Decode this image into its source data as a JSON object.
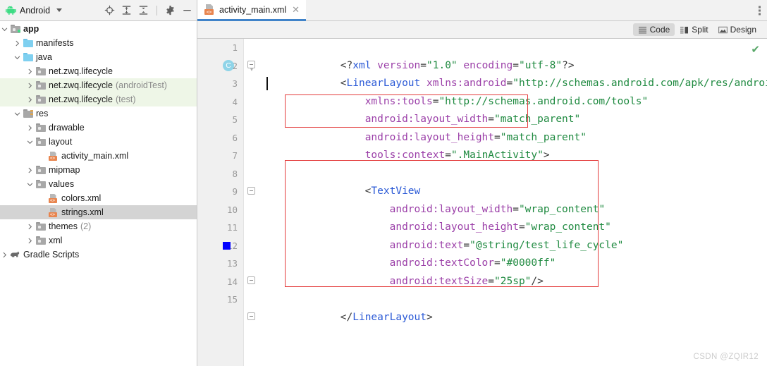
{
  "window": {
    "panel_title": "Android",
    "panel_dropdown_icon": "chevron-down-icon",
    "toolbar_icons": [
      "locate-target-icon",
      "expand-all-icon",
      "collapse-all-icon",
      "settings-gear-icon",
      "minimize-icon"
    ],
    "more_options_icon": "more-vertical-icon"
  },
  "sidebar": {
    "items": [
      {
        "label": "app",
        "suffix": "",
        "depth": 0,
        "arrow": "down",
        "icon": "folder-module-icon",
        "state": "normal",
        "bold": true
      },
      {
        "label": "manifests",
        "suffix": "",
        "depth": 1,
        "arrow": "right",
        "icon": "folder-blue-icon",
        "state": "normal",
        "bold": false
      },
      {
        "label": "java",
        "suffix": "",
        "depth": 1,
        "arrow": "down",
        "icon": "folder-blue-icon",
        "state": "normal",
        "bold": false
      },
      {
        "label": "net.zwq.lifecycle",
        "suffix": "",
        "depth": 2,
        "arrow": "right",
        "icon": "folder-package-icon",
        "state": "normal",
        "bold": false
      },
      {
        "label": "net.zwq.lifecycle",
        "suffix": "(androidTest)",
        "depth": 2,
        "arrow": "right",
        "icon": "folder-package-icon",
        "state": "green",
        "bold": false
      },
      {
        "label": "net.zwq.lifecycle",
        "suffix": "(test)",
        "depth": 2,
        "arrow": "right",
        "icon": "folder-package-icon",
        "state": "green",
        "bold": false
      },
      {
        "label": "res",
        "suffix": "",
        "depth": 1,
        "arrow": "down",
        "icon": "folder-res-icon",
        "state": "normal",
        "bold": false
      },
      {
        "label": "drawable",
        "suffix": "",
        "depth": 2,
        "arrow": "right",
        "icon": "folder-package-icon",
        "state": "normal",
        "bold": false
      },
      {
        "label": "layout",
        "suffix": "",
        "depth": 2,
        "arrow": "down",
        "icon": "folder-package-icon",
        "state": "normal",
        "bold": false
      },
      {
        "label": "activity_main.xml",
        "suffix": "",
        "depth": 3,
        "arrow": "none",
        "icon": "xml-file-icon",
        "state": "normal",
        "bold": false
      },
      {
        "label": "mipmap",
        "suffix": "",
        "depth": 2,
        "arrow": "right",
        "icon": "folder-package-icon",
        "state": "normal",
        "bold": false
      },
      {
        "label": "values",
        "suffix": "",
        "depth": 2,
        "arrow": "down",
        "icon": "folder-package-icon",
        "state": "normal",
        "bold": false
      },
      {
        "label": "colors.xml",
        "suffix": "",
        "depth": 3,
        "arrow": "none",
        "icon": "xml-file-icon",
        "state": "normal",
        "bold": false
      },
      {
        "label": "strings.xml",
        "suffix": "",
        "depth": 3,
        "arrow": "none",
        "icon": "xml-file-icon",
        "state": "selected",
        "bold": false
      },
      {
        "label": "themes",
        "suffix": "(2)",
        "depth": 2,
        "arrow": "right",
        "icon": "folder-package-icon",
        "state": "normal",
        "bold": false
      },
      {
        "label": "xml",
        "suffix": "",
        "depth": 2,
        "arrow": "right",
        "icon": "folder-package-icon",
        "state": "normal",
        "bold": false
      },
      {
        "label": "Gradle Scripts",
        "suffix": "",
        "depth": 0,
        "arrow": "right",
        "icon": "gradle-elephant-icon",
        "state": "normal",
        "bold": false
      }
    ]
  },
  "editor": {
    "tab": {
      "label": "activity_main.xml",
      "icon": "xml-file-icon",
      "close_icon": "close-icon"
    },
    "view_modes": [
      {
        "label": "Code",
        "icon": "code-lines-icon",
        "active": true
      },
      {
        "label": "Split",
        "icon": "split-view-icon",
        "active": false
      },
      {
        "label": "Design",
        "icon": "design-view-icon",
        "active": false
      }
    ],
    "inspection_status_icon": "green-check-icon",
    "class_marker_badge": "C",
    "color_swatch_hex": "#0000ff",
    "cursor_line": 3,
    "lines": [
      {
        "n": 1,
        "text": "<?xml version=\"1.0\" encoding=\"utf-8\"?>"
      },
      {
        "n": 2,
        "text": "<LinearLayout xmlns:android=\"http://schemas.android.com/apk/res/android\""
      },
      {
        "n": 3,
        "text": "    xmlns:tools=\"http://schemas.android.com/tools\""
      },
      {
        "n": 4,
        "text": "    android:layout_width=\"match_parent\""
      },
      {
        "n": 5,
        "text": "    android:layout_height=\"match_parent\""
      },
      {
        "n": 6,
        "text": "    tools:context=\".MainActivity\">"
      },
      {
        "n": 7,
        "text": ""
      },
      {
        "n": 8,
        "text": "    <TextView"
      },
      {
        "n": 9,
        "text": "        android:layout_width=\"wrap_content\""
      },
      {
        "n": 10,
        "text": "        android:layout_height=\"wrap_content\""
      },
      {
        "n": 11,
        "text": "        android:text=\"@string/test_life_cycle\""
      },
      {
        "n": 12,
        "text": "        android:textColor=\"#0000ff\""
      },
      {
        "n": 13,
        "text": "        android:textSize=\"25sp\"/>"
      },
      {
        "n": 14,
        "text": ""
      },
      {
        "n": 15,
        "text": "</LinearLayout>"
      }
    ],
    "annotation_boxes": [
      {
        "name": "linearlayout-size-attrs-highlight",
        "lines": [
          4,
          5
        ]
      },
      {
        "name": "textview-block-highlight",
        "lines": [
          8,
          13
        ]
      }
    ]
  },
  "colors": {
    "accent_tab_underline": "#4083c9",
    "selection_gray": "#d4d4d4",
    "test_source_green": "#eef6e7",
    "annotation_red": "#e33b3b",
    "xml_tag_blue": "#2a59d6",
    "xml_attr_purple": "#9b3fa8",
    "xml_value_green": "#1f8a40",
    "status_check_green": "#59a869"
  },
  "watermark": {
    "text": "CSDN @ZQIR12"
  }
}
